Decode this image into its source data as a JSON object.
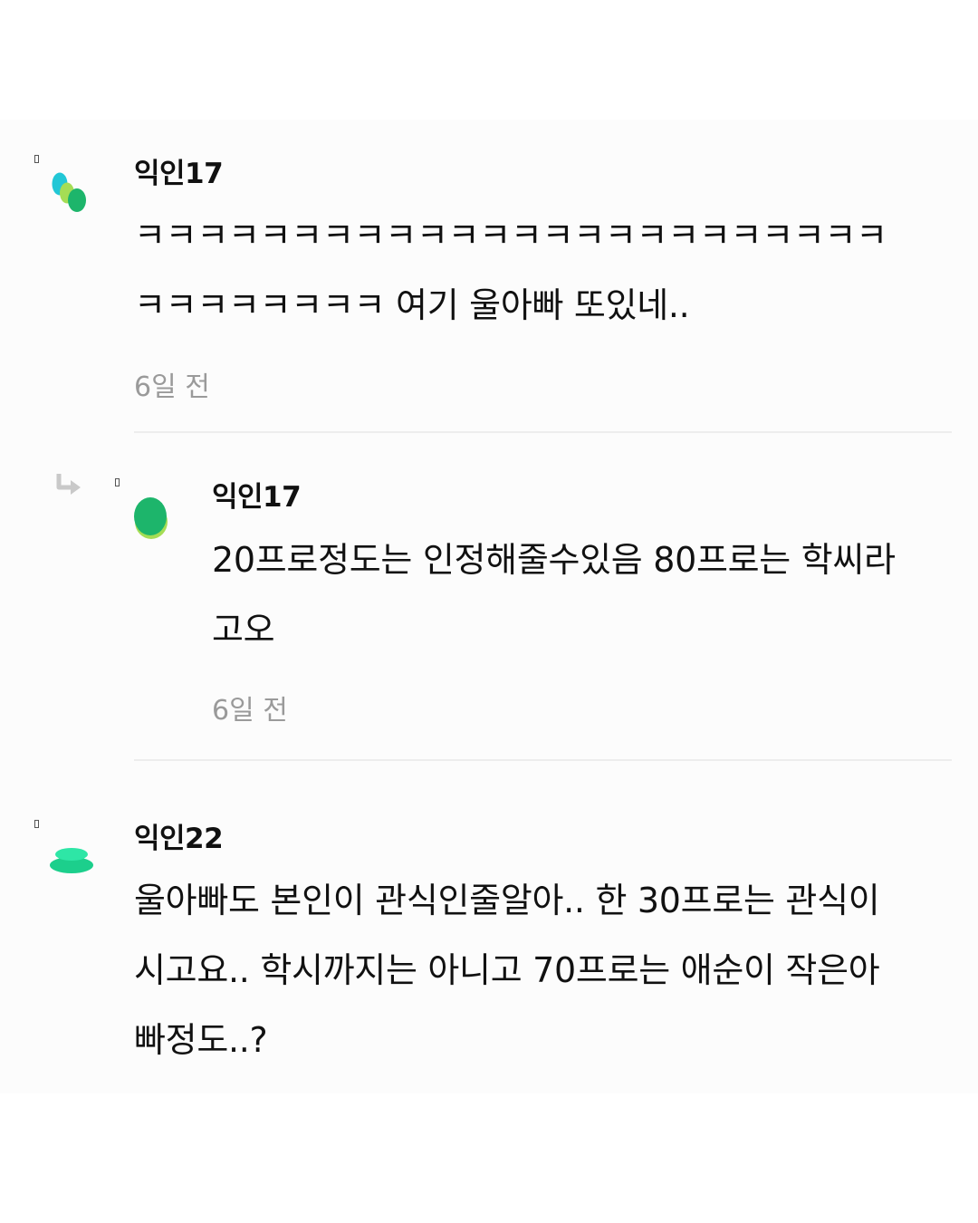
{
  "comments": [
    {
      "author": "익인17",
      "lines": [
        "ㅋㅋㅋㅋㅋㅋㅋㅋㅋㅋㅋㅋㅋㅋㅋㅋㅋㅋㅋㅋㅋㅋㅋㅋ",
        "ㅋㅋㅋㅋㅋㅋㅋㅋ 여기 울아빠 또있네.."
      ],
      "time": "6일 전",
      "avatar_colors": [
        "#22c7d6",
        "#a5dd55",
        "#1db56b"
      ]
    },
    {
      "author": "익인17",
      "lines": [
        "20프로정도는 인정해줄수있음 80프로는 학씨라",
        "고오"
      ],
      "time": "6일 전",
      "is_reply": true,
      "avatar_colors": [
        "#1db56b",
        "#a5dd55"
      ]
    },
    {
      "author": "익인22",
      "lines": [
        "울아빠도 본인이 관식인줄알아.. 한 30프로는 관식이",
        "시고요.. 학시까지는 아니고 70프로는 애순이 작은아",
        "빠정도..?"
      ],
      "avatar_colors": [
        "#2ee6a6",
        "#1ccf8c"
      ]
    }
  ]
}
